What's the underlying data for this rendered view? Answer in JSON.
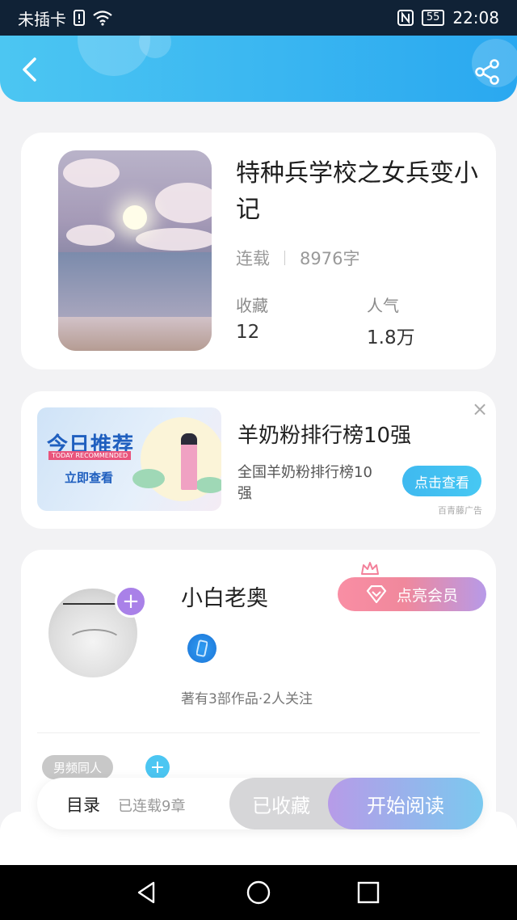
{
  "statusbar": {
    "carrier": "未插卡",
    "battery": "55",
    "time": "22:08"
  },
  "header": {
    "back_icon": "chevron-left-icon",
    "share_icon": "share-icon"
  },
  "book": {
    "title": "特种兵学校之女兵变小记",
    "status": "连载",
    "word_count": "8976字",
    "favorites_label": "收藏",
    "favorites_value": "12",
    "popularity_label": "人气",
    "popularity_value": "1.8万"
  },
  "ad": {
    "image_title": "今日推荐",
    "image_subtitle": "TODAY RECOMMENDED",
    "image_cta": "立即查看",
    "title": "羊奶粉排行榜10强",
    "description": "全国羊奶粉排行榜10强",
    "button": "点击查看",
    "close": "×",
    "source": "百青藤广告"
  },
  "author": {
    "name": "小白老奥",
    "vip_button": "点亮会员",
    "stats": "著有3部作品·2人关注",
    "tag": "男频同人",
    "add_icon": "plus-icon"
  },
  "bottom_bar": {
    "toc_label": "目录",
    "toc_sub": "已连载9章",
    "collected_label": "已收藏",
    "read_label": "开始阅读"
  },
  "colors": {
    "header_start": "#4cc6f2",
    "header_end": "#2aa8f0",
    "vip_start": "#f98ea4",
    "vip_end": "#b79ae8",
    "read_start": "#b79be8",
    "read_end": "#7ac9ef"
  }
}
